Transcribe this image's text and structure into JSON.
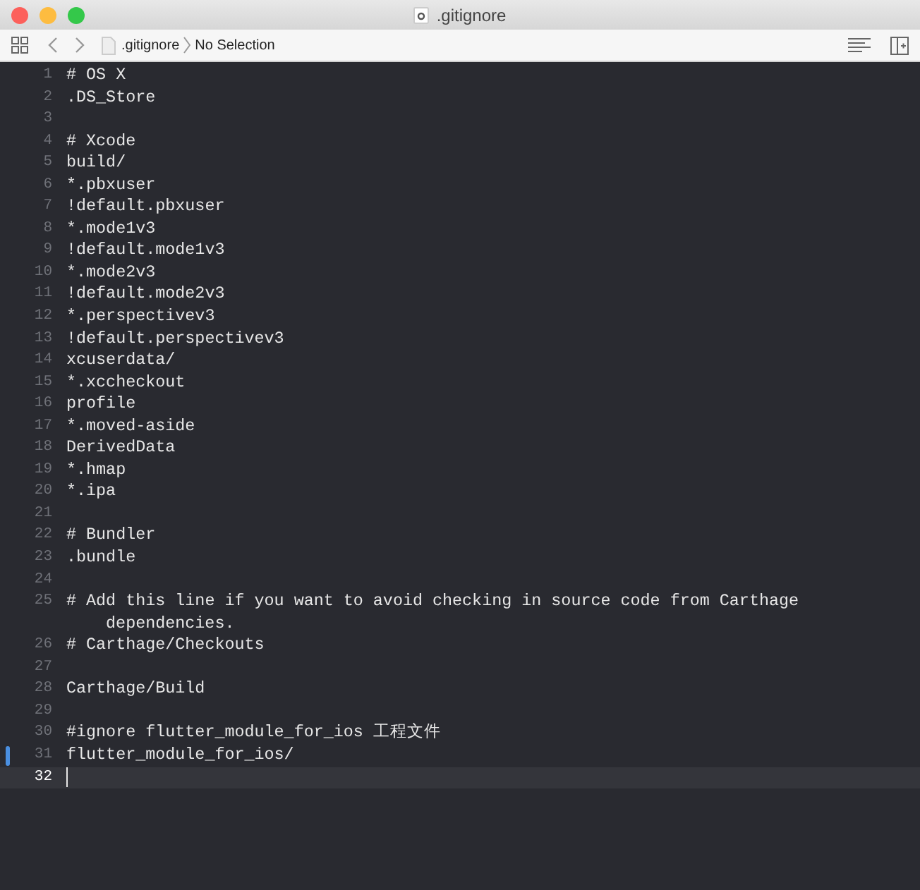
{
  "window": {
    "title": ".gitignore"
  },
  "jump_bar": {
    "file": ".gitignore",
    "selection": "No Selection"
  },
  "lines": [
    {
      "number": "1",
      "text": "# OS X",
      "current": false,
      "modified": false
    },
    {
      "number": "2",
      "text": ".DS_Store",
      "current": false,
      "modified": false
    },
    {
      "number": "3",
      "current": false,
      "modified": false
    },
    {
      "number": "4",
      "text": "# Xcode",
      "current": false,
      "modified": false
    },
    {
      "number": "5",
      "text": "build/",
      "current": false,
      "modified": false
    },
    {
      "number": "6",
      "text": "*.pbxuser",
      "current": false,
      "modified": false
    },
    {
      "number": "7",
      "text": "!default.pbxuser",
      "current": false,
      "modified": false
    },
    {
      "number": "8",
      "text": "*.mode1v3",
      "current": false,
      "modified": false
    },
    {
      "number": "9",
      "text": "!default.mode1v3",
      "current": false,
      "modified": false
    },
    {
      "number": "10",
      "text": "*.mode2v3",
      "current": false,
      "modified": false
    },
    {
      "number": "11",
      "text": "!default.mode2v3",
      "current": false,
      "modified": false
    },
    {
      "number": "12",
      "text": "*.perspectivev3",
      "current": false,
      "modified": false
    },
    {
      "number": "13",
      "text": "!default.perspectivev3",
      "current": false,
      "modified": false
    },
    {
      "number": "14",
      "text": "xcuserdata/",
      "current": false,
      "modified": false
    },
    {
      "number": "15",
      "text": "*.xccheckout",
      "current": false,
      "modified": false
    },
    {
      "number": "16",
      "text": "profile",
      "current": false,
      "modified": false
    },
    {
      "number": "17",
      "text": "*.moved-aside",
      "current": false,
      "modified": false
    },
    {
      "number": "18",
      "text": "DerivedData",
      "current": false,
      "modified": false
    },
    {
      "number": "19",
      "text": "*.hmap",
      "current": false,
      "modified": false
    },
    {
      "number": "20",
      "text": "*.ipa",
      "current": false,
      "modified": false
    },
    {
      "number": "21",
      "current": false,
      "modified": false
    },
    {
      "number": "22",
      "text": "# Bundler",
      "current": false,
      "modified": false
    },
    {
      "number": "23",
      "text": ".bundle",
      "current": false,
      "modified": false
    },
    {
      "number": "24",
      "current": false,
      "modified": false
    },
    {
      "number": "25",
      "text": "# Add this line if you want to avoid checking in source code from Carthage dependencies.",
      "current": false,
      "modified": false
    },
    {
      "number": "26",
      "text": "# Carthage/Checkouts",
      "current": false,
      "modified": false
    },
    {
      "number": "27",
      "current": false,
      "modified": false
    },
    {
      "number": "28",
      "text": "Carthage/Build",
      "current": false,
      "modified": false
    },
    {
      "number": "29",
      "current": false,
      "modified": false
    },
    {
      "number": "30",
      "text": "#ignore flutter_module_for_ios 工程文件",
      "current": false,
      "modified": false
    },
    {
      "number": "31",
      "text": "flutter_module_for_ios/",
      "current": false,
      "modified": true
    },
    {
      "number": "32",
      "current": true,
      "modified": false
    }
  ]
}
